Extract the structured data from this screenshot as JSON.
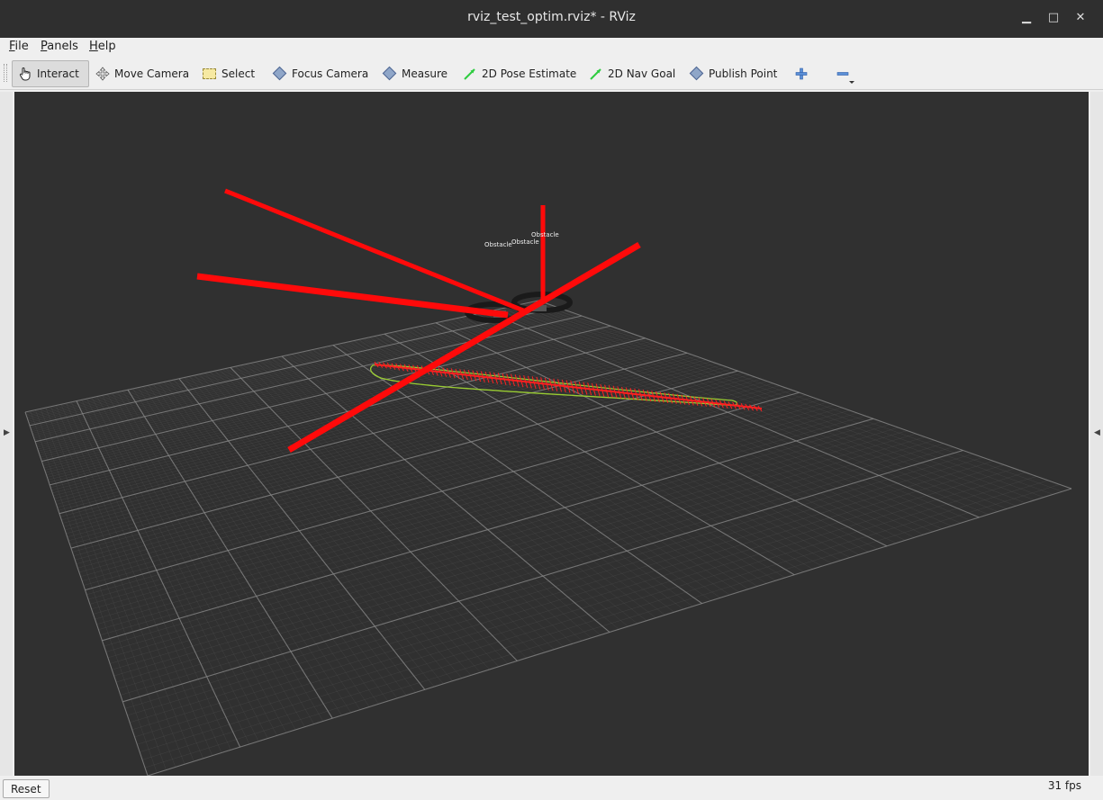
{
  "window": {
    "title": "rviz_test_optim.rviz* - RViz",
    "minimize_glyph": "▁",
    "maximize_glyph": "□",
    "close_glyph": "✕"
  },
  "menu": [
    {
      "label": "File",
      "accel": "F",
      "rest": "ile"
    },
    {
      "label": "Panels",
      "accel": "P",
      "rest": "anels"
    },
    {
      "label": "Help",
      "accel": "H",
      "rest": "elp"
    }
  ],
  "toolbar": {
    "tools": [
      {
        "label": "Interact",
        "icon": "hand-pointer-icon",
        "active": true
      },
      {
        "label": "Move Camera",
        "icon": "move-camera-icon",
        "active": false
      },
      {
        "label": "Select",
        "icon": "select-box-icon",
        "active": false
      },
      {
        "label": "Focus Camera",
        "icon": "diamond-icon",
        "active": false
      },
      {
        "label": "Measure",
        "icon": "diamond-icon",
        "active": false
      },
      {
        "label": "2D Pose Estimate",
        "icon": "green-arrow-icon",
        "active": false
      },
      {
        "label": "2D Nav Goal",
        "icon": "green-arrow-icon",
        "active": false
      },
      {
        "label": "Publish Point",
        "icon": "diamond-icon",
        "active": false
      }
    ],
    "add_tool_icon": "plus-icon",
    "remove_tool_icon": "minus-icon"
  },
  "viewport": {
    "background": "#303030",
    "grid_color": "#8a8a8a",
    "path_color": "#ff2020",
    "footprint_color": "#9acd32",
    "obstacle_labels": [
      "Obstacle",
      "Obstacle",
      "Obstacle"
    ]
  },
  "statusbar": {
    "reset_label": "Reset",
    "fps": "31 fps"
  }
}
